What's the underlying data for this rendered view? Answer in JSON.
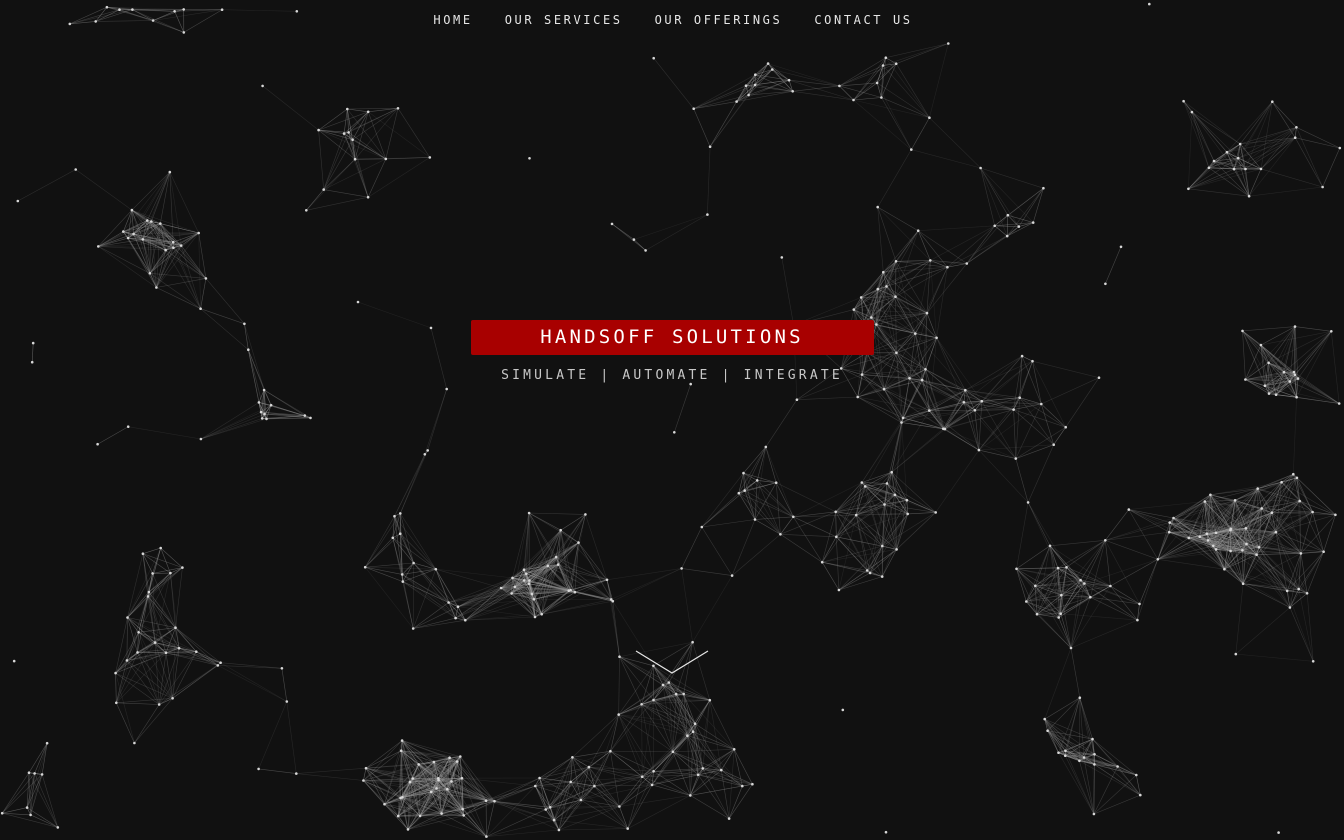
{
  "nav": {
    "items": [
      "HOME",
      "OUR SERVICES",
      "OUR OFFERINGS",
      "CONTACT US"
    ]
  },
  "hero": {
    "brand": "HANDSOFF SOLUTIONS",
    "tagline": "SIMULATE | AUTOMATE | INTEGRATE"
  },
  "icons": {
    "scroll": "chevron-down-icon"
  },
  "colors": {
    "background": "#111111",
    "accent": "#a80000",
    "text": "#e6e6e6",
    "network": "#9a9a9a"
  }
}
